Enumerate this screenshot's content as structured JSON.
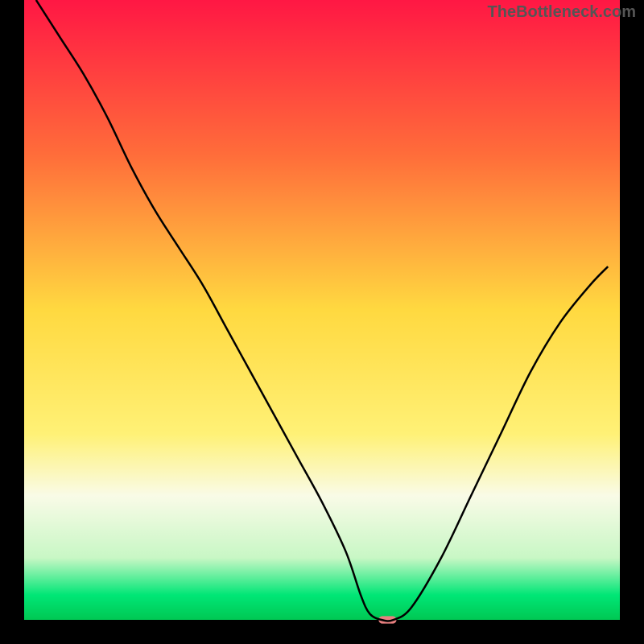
{
  "watermark": "TheBottleneck.com",
  "chart_data": {
    "type": "line",
    "title": "",
    "xlabel": "",
    "ylabel": "",
    "xlim": [
      0,
      100
    ],
    "ylim": [
      0,
      100
    ],
    "series": [
      {
        "name": "bottleneck-curve",
        "x": [
          2,
          6,
          10,
          14,
          18,
          22,
          26,
          30,
          34,
          38,
          42,
          46,
          50,
          54,
          56.5,
          58,
          60,
          62,
          65,
          70,
          75,
          80,
          85,
          90,
          95,
          98
        ],
        "y": [
          100,
          94,
          88,
          81,
          73,
          66,
          60,
          54,
          47,
          40,
          33,
          26,
          19,
          11,
          4,
          1,
          0,
          0,
          2,
          10,
          20,
          30,
          40,
          48,
          54,
          57
        ]
      }
    ],
    "marker": {
      "x_center": 61,
      "y_center": 0,
      "width": 3,
      "height": 1.2,
      "color": "#e88080"
    },
    "gradient_stops": [
      {
        "offset": 0,
        "color": "#ff1744"
      },
      {
        "offset": 25,
        "color": "#ff6d3a"
      },
      {
        "offset": 50,
        "color": "#ffd940"
      },
      {
        "offset": 70,
        "color": "#fff176"
      },
      {
        "offset": 80,
        "color": "#f9fbe7"
      },
      {
        "offset": 90,
        "color": "#c8f7c5"
      },
      {
        "offset": 96,
        "color": "#00e676"
      },
      {
        "offset": 100,
        "color": "#00c853"
      }
    ],
    "border_color": "#000000",
    "border_width": 30
  }
}
